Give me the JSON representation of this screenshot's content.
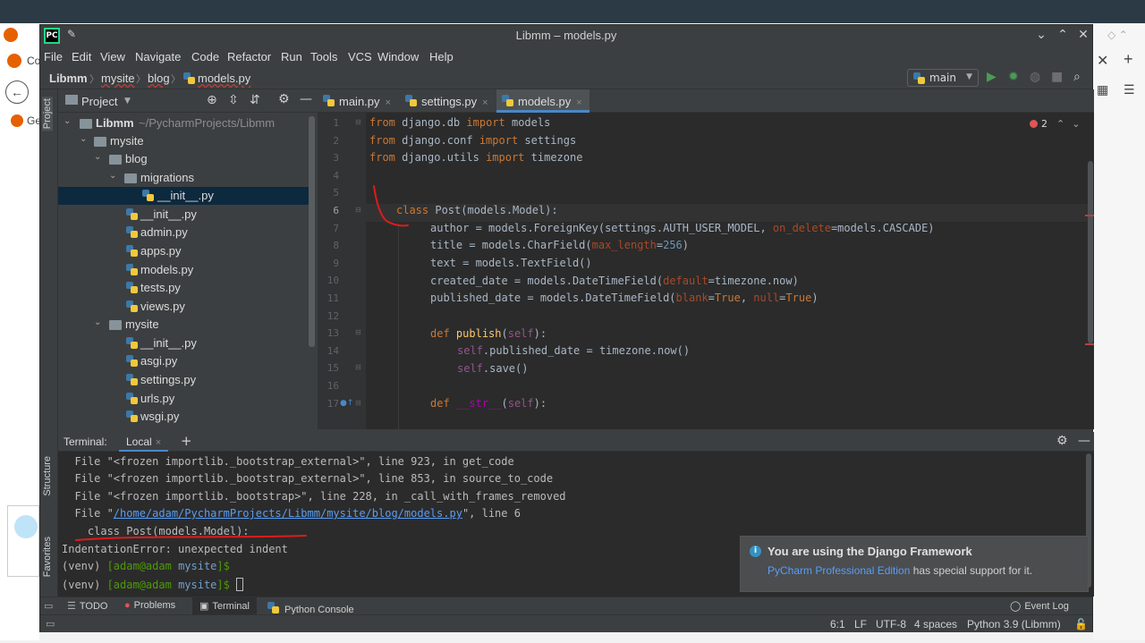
{
  "window": {
    "title": "Libmm – models.py",
    "logo": "PC"
  },
  "menu": [
    "File",
    "Edit",
    "View",
    "Navigate",
    "Code",
    "Refactor",
    "Run",
    "Tools",
    "VCS",
    "Window",
    "Help"
  ],
  "breadcrumb": [
    "Libmm",
    "mysite",
    "blog",
    "models.py"
  ],
  "run_config": "main",
  "left_strip": {
    "project": "Project",
    "structure": "Structure",
    "favorites": "Favorites"
  },
  "project_panel": {
    "title": "Project",
    "root": {
      "name": "Libmm",
      "path": "~/PycharmProjects/Libmm"
    },
    "items": [
      "mysite",
      "blog",
      "migrations",
      "__init__.py",
      "__init__.py",
      "admin.py",
      "apps.py",
      "models.py",
      "tests.py",
      "views.py",
      "mysite",
      "__init__.py",
      "asgi.py",
      "settings.py",
      "urls.py",
      "wsgi.py"
    ]
  },
  "editor": {
    "tabs": [
      "main.py",
      "settings.py",
      "models.py"
    ],
    "problems_count": "2",
    "line_numbers": [
      "1",
      "2",
      "3",
      "4",
      "5",
      "6",
      "7",
      "8",
      "9",
      "10",
      "11",
      "12",
      "13",
      "14",
      "15",
      "16",
      "17"
    ],
    "code": {
      "l1": {
        "a": "from",
        "b": " django.db ",
        "c": "import",
        "d": " models"
      },
      "l2": {
        "a": "from",
        "b": " django.conf ",
        "c": "import",
        "d": " settings"
      },
      "l3": {
        "a": "from",
        "b": " django.utils ",
        "c": "import",
        "d": " timezone"
      },
      "l6": {
        "a": "class",
        "b": " Post(models.Model):"
      },
      "l7": {
        "a": "author = models.ForeignKey(settings.AUTH_USER_MODEL, ",
        "b": "on_delete",
        "c": "=models.CASCADE)"
      },
      "l8": {
        "a": "title = models.CharField(",
        "b": "max_length",
        "c": "=",
        "d": "256",
        "e": ")"
      },
      "l9": {
        "a": "text = models.TextField()"
      },
      "l10": {
        "a": "created_date = models.DateTimeField(",
        "b": "default",
        "c": "=timezone.now)"
      },
      "l11": {
        "a": "published_date = models.DateTimeField(",
        "b": "blank",
        "c": "=",
        "d": "True",
        "e": ", ",
        "f": "null",
        "g": "=",
        "h": "True",
        "i": ")"
      },
      "l13": {
        "a": "def",
        "b": " ",
        "c": "publish",
        "d": "(",
        "e": "self",
        "f": "):"
      },
      "l14": {
        "a": "self",
        "b": ".published_date = timezone.now()"
      },
      "l15": {
        "a": "self",
        "b": ".save()"
      },
      "l17": {
        "a": "def",
        "b": " ",
        "c": "__str__",
        "d": "(",
        "e": "self",
        "f": "):"
      }
    }
  },
  "terminal": {
    "title": "Terminal:",
    "tab": "Local",
    "lines": {
      "t1": "  File \"<frozen importlib._bootstrap_external>\", line 923, in get_code",
      "t2": "  File \"<frozen importlib._bootstrap_external>\", line 853, in source_to_code",
      "t3": "  File \"<frozen importlib._bootstrap>\", line 228, in _call_with_frames_removed",
      "t4a": "  File \"",
      "t4b": "/home/adam/PycharmProjects/Libmm/mysite/blog/models.py",
      "t4c": "\", line 6",
      "t5": "    class Post(models.Model):",
      "t6": "IndentationError: unexpected indent",
      "p_venv": "(venv) ",
      "p_user": "[adam@adam ",
      "p_dir": "mysite",
      "p_end": "]$"
    }
  },
  "notification": {
    "title": "You are using the Django Framework",
    "link": "PyCharm Professional Edition",
    "body": " has special support for it."
  },
  "bottom_tabs": [
    "TODO",
    "Problems",
    "Terminal",
    "Python Console"
  ],
  "event_log": "Event Log",
  "status": {
    "position": "6:1",
    "line_sep": "LF",
    "encoding": "UTF-8",
    "indent": "4 spaces",
    "interpreter": "Python 3.9 (Libmm)"
  },
  "browser": {
    "tab1": "Co",
    "tab2": "Ge"
  },
  "colors": {
    "accent": "#4a88c7",
    "annotation": "#e01b1b",
    "run": "#499c54"
  }
}
